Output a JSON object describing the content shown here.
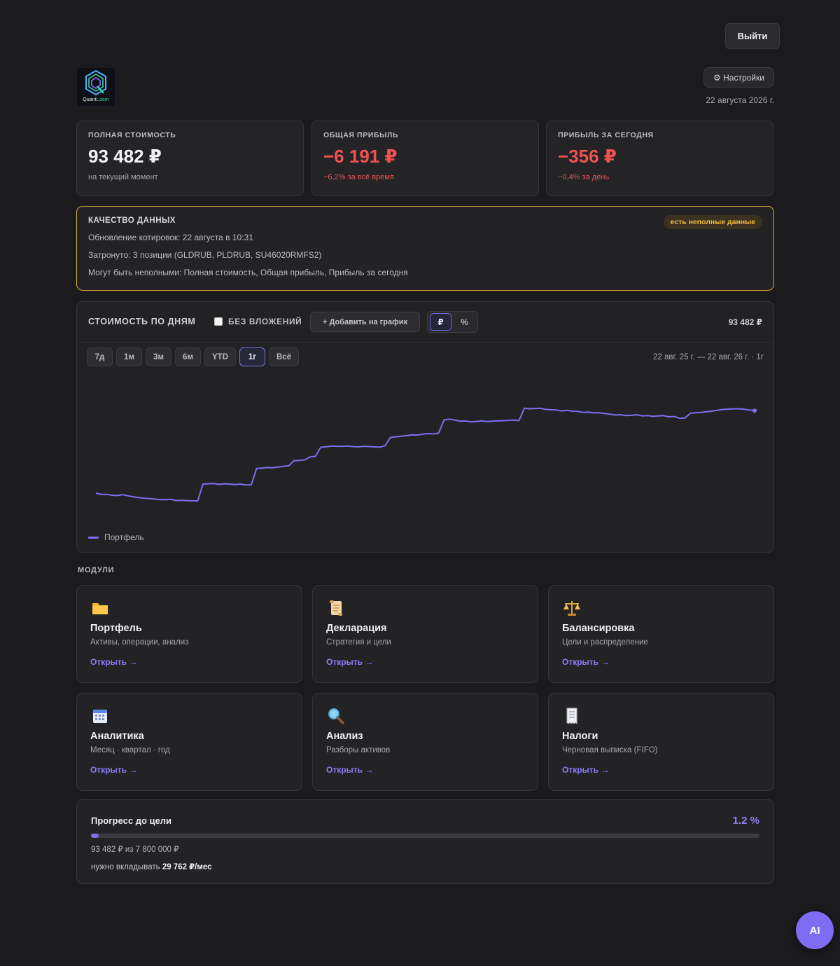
{
  "header": {
    "logout_label": "Выйти",
    "logo": {
      "text_main": "Quant",
      "text_accent": "Loom"
    },
    "settings_label": "⚙ Настройки",
    "date": "22 августа 2026 г."
  },
  "stats": [
    {
      "title": "ПОЛНАЯ СТОИМОСТЬ",
      "value": "93 482 ₽",
      "sub": "на текущий момент",
      "negative": false
    },
    {
      "title": "ОБЩАЯ ПРИБЫЛЬ",
      "value": "−6 191 ₽",
      "sub": "−6,2% за всё время",
      "negative": true
    },
    {
      "title": "ПРИБЫЛЬ ЗА СЕГОДНЯ",
      "value": "−356 ₽",
      "sub": "−0,4% за день",
      "negative": true
    }
  ],
  "data_quality": {
    "title": "КАЧЕСТВО ДАННЫХ",
    "badge": "есть неполные данные",
    "lines": [
      "Обновление котировок: 22 августа в 10:31",
      "Затронуто: 3 позиции (GLDRUB, PLDRUB, SU46020RMFS2)",
      "Могут быть неполными: Полная стоимость, Общая прибыль, Прибыль за сегодня"
    ]
  },
  "chart_panel": {
    "title": "СТОИМОСТЬ ПО ДНЯМ",
    "no_deposits_label": "БЕЗ ВЛОЖЕНИЙ",
    "add_label": "+ Добавить на график",
    "units": [
      "₽",
      "%"
    ],
    "active_unit": "₽",
    "total": "93 482 ₽",
    "ranges": [
      "7д",
      "1м",
      "3м",
      "6м",
      "YTD",
      "1г",
      "Всё"
    ],
    "active_range": "1г",
    "range_label": "22 авг. 25 г. — 22 авг. 26 г. · 1г"
  },
  "chart_data": {
    "type": "line",
    "x_range": [
      "2025-08-22",
      "2026-08-22"
    ],
    "grid": false,
    "legend_position": "bottom-left",
    "series": [
      {
        "name": "Портфель",
        "color": "#7c6ff0",
        "values": [
          51.4,
          51.0,
          51.0,
          50.7,
          50.6,
          50.9,
          50.5,
          50.2,
          49.9,
          49.7,
          49.6,
          49.4,
          49.2,
          49.2,
          49.3,
          48.9,
          49.0,
          48.9,
          48.8,
          48.8,
          54.5,
          54.6,
          54.7,
          54.4,
          54.6,
          54.5,
          54.3,
          54.5,
          54.2,
          54.2,
          59.8,
          59.9,
          60.1,
          60.0,
          60.3,
          60.5,
          60.7,
          62.4,
          62.5,
          62.7,
          63.7,
          63.9,
          67.0,
          67.1,
          67.4,
          67.3,
          67.3,
          67.4,
          67.2,
          67.1,
          67.3,
          67.2,
          67.1,
          67.0,
          67.5,
          70.3,
          70.5,
          70.7,
          70.9,
          71.2,
          71.1,
          71.4,
          71.6,
          71.5,
          71.8,
          76.2,
          76.5,
          76.2,
          75.8,
          75.9,
          75.6,
          75.7,
          75.9,
          75.7,
          75.8,
          75.9,
          76.0,
          76.1,
          76.2,
          76.0,
          80.2,
          80.0,
          80.1,
          80.2,
          79.8,
          79.7,
          79.6,
          79.3,
          79.5,
          79.2,
          79.1,
          78.8,
          78.9,
          78.6,
          78.7,
          78.4,
          78.2,
          77.9,
          78.0,
          77.7,
          77.8,
          78.0,
          77.6,
          77.7,
          77.5,
          77.6,
          77.7,
          77.3,
          77.4,
          76.8,
          76.9,
          78.5,
          78.7,
          78.8,
          79.0,
          79.2,
          79.5,
          79.8,
          79.9,
          80.0,
          80.0,
          79.9,
          79.6,
          79.4
        ]
      }
    ],
    "unit": "тыс. ₽",
    "last_value": "93 482 ₽"
  },
  "modules_label": "МОДУЛИ",
  "modules": [
    {
      "icon": "folder-icon",
      "title": "Портфель",
      "desc": "Активы, операции, анализ",
      "link": "Открыть →"
    },
    {
      "icon": "scroll-icon",
      "title": "Декларация",
      "desc": "Стратегия и цели",
      "link": "Открыть →"
    },
    {
      "icon": "scales-icon",
      "title": "Балансировка",
      "desc": "Цели и распределение",
      "link": "Открыть →"
    },
    {
      "icon": "calendar-icon",
      "title": "Аналитика",
      "desc": "Месяц · квартал · год",
      "link": "Открыть →"
    },
    {
      "icon": "magnifier-icon",
      "title": "Анализ",
      "desc": "Разборы активов",
      "link": "Открыть →"
    },
    {
      "icon": "receipt-icon",
      "title": "Налоги",
      "desc": "Черновая выписка (FIFO)",
      "link": "Открыть →"
    }
  ],
  "goal": {
    "title": "Прогресс до цели",
    "percent_label": "1.2 %",
    "percent": 1.2,
    "sub": "93 482 ₽ из 7 800 000 ₽",
    "need_prefix": "нужно вкладывать",
    "need_amount": "29 762 ₽/мес"
  },
  "ai_label": "AI",
  "colors": {
    "accent": "#7c6ff0",
    "negative": "#f05252",
    "warning": "#d8aa3a"
  }
}
